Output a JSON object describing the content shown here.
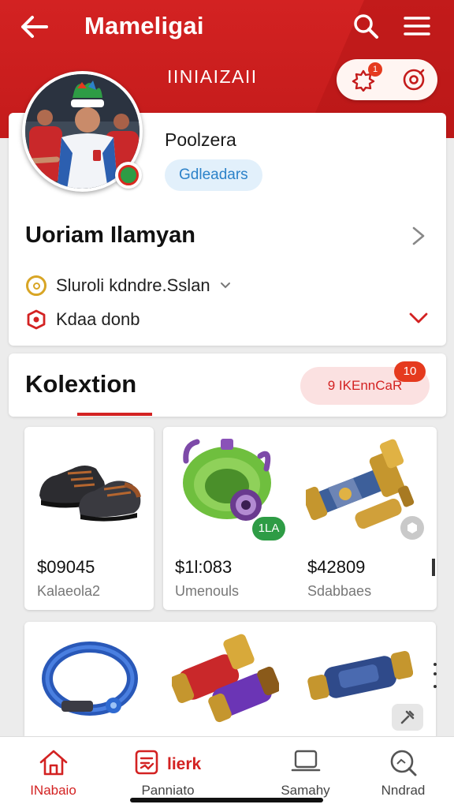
{
  "header": {
    "title": "Mameligai",
    "banner": "IINIAIZAII",
    "notif_count": "1",
    "back_icon": "arrow-left-icon",
    "search_icon": "search-icon",
    "menu_icon": "hamburger-menu-icon"
  },
  "profile": {
    "name": "Poolzera",
    "tag": "Gdleadars",
    "display_name": "Uoriam Ilamyan",
    "row1_label": "Sluroli kdndre.Sslan",
    "row2_label": "Kdaa donb"
  },
  "collection": {
    "title": "Kolextion",
    "button_label": "9 IKEnnCaR",
    "badge": "10"
  },
  "items": [
    {
      "price": "$09045",
      "subtitle": "Kalaeola2",
      "icon": "shoes-icon"
    },
    {
      "price": "$1l:083",
      "subtitle": "Umenouls",
      "icon": "goggles-icon",
      "badge": "1LA"
    },
    {
      "price": "$42809",
      "subtitle": "Sdabbaes",
      "icon": "scroll-tube-icon"
    },
    {
      "price": "",
      "subtitle": "",
      "icon": "bracelet-icon"
    },
    {
      "price": "",
      "subtitle": "",
      "icon": "rocket-cylinder-icon"
    },
    {
      "price": "",
      "subtitle": "",
      "icon": "sleeve-cylinder-icon"
    }
  ],
  "bottom_nav": {
    "home": "INabaio",
    "center": "Panniato",
    "center_pill": "lierk",
    "saved": "Samahy",
    "search": "Nndrad"
  },
  "colors": {
    "brand_red": "#d32222",
    "accent_blue": "#2c82c9",
    "success_green": "#2e9c45"
  }
}
